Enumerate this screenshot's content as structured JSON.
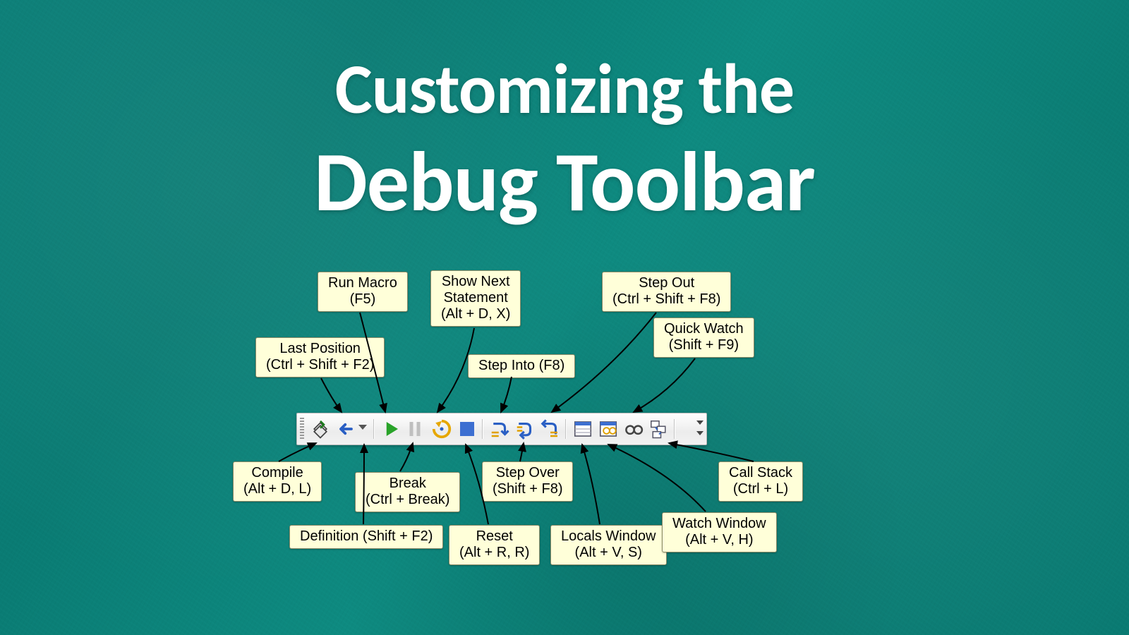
{
  "title": {
    "line1": "Customizing the",
    "line2": "Debug Toolbar"
  },
  "callouts": {
    "compile": {
      "title": "Compile",
      "shortcut": "(Alt + D, L)"
    },
    "lastpos": {
      "title": "Last Position",
      "shortcut": "(Ctrl + Shift + F2)"
    },
    "definition": {
      "title": "Definition (Shift + F2)",
      "shortcut": ""
    },
    "runmacro": {
      "title": "Run Macro",
      "shortcut": "(F5)"
    },
    "break": {
      "title": "Break",
      "shortcut": "(Ctrl + Break)"
    },
    "shownext": {
      "title": "Show Next",
      "subtitle": "Statement",
      "shortcut": "(Alt + D, X)"
    },
    "reset": {
      "title": "Reset",
      "shortcut": "(Alt + R, R)"
    },
    "stepinto": {
      "title": "Step Into (F8)",
      "shortcut": ""
    },
    "stepover": {
      "title": "Step Over",
      "shortcut": "(Shift + F8)"
    },
    "stepout": {
      "title": "Step Out",
      "shortcut": "(Ctrl + Shift + F8)"
    },
    "locals": {
      "title": "Locals Window",
      "shortcut": "(Alt + V, S)"
    },
    "quickwatch": {
      "title": "Quick Watch",
      "shortcut": "(Shift + F9)"
    },
    "watchwin": {
      "title": "Watch Window",
      "shortcut": "(Alt + V, H)"
    },
    "callstack": {
      "title": "Call Stack",
      "shortcut": "(Ctrl + L)"
    }
  },
  "icons": {
    "compile": "compile-icon",
    "lastpos": "last-position-icon",
    "definition": "definition-icon",
    "run": "run-macro-icon",
    "break": "break-icon",
    "shownext": "show-next-statement-icon",
    "reset": "reset-icon",
    "stepinto": "step-into-icon",
    "stepover": "step-over-icon",
    "stepout": "step-out-icon",
    "locals": "locals-window-icon",
    "watch": "watch-window-icon",
    "quickwatch": "quick-watch-icon",
    "callstack": "call-stack-icon"
  }
}
